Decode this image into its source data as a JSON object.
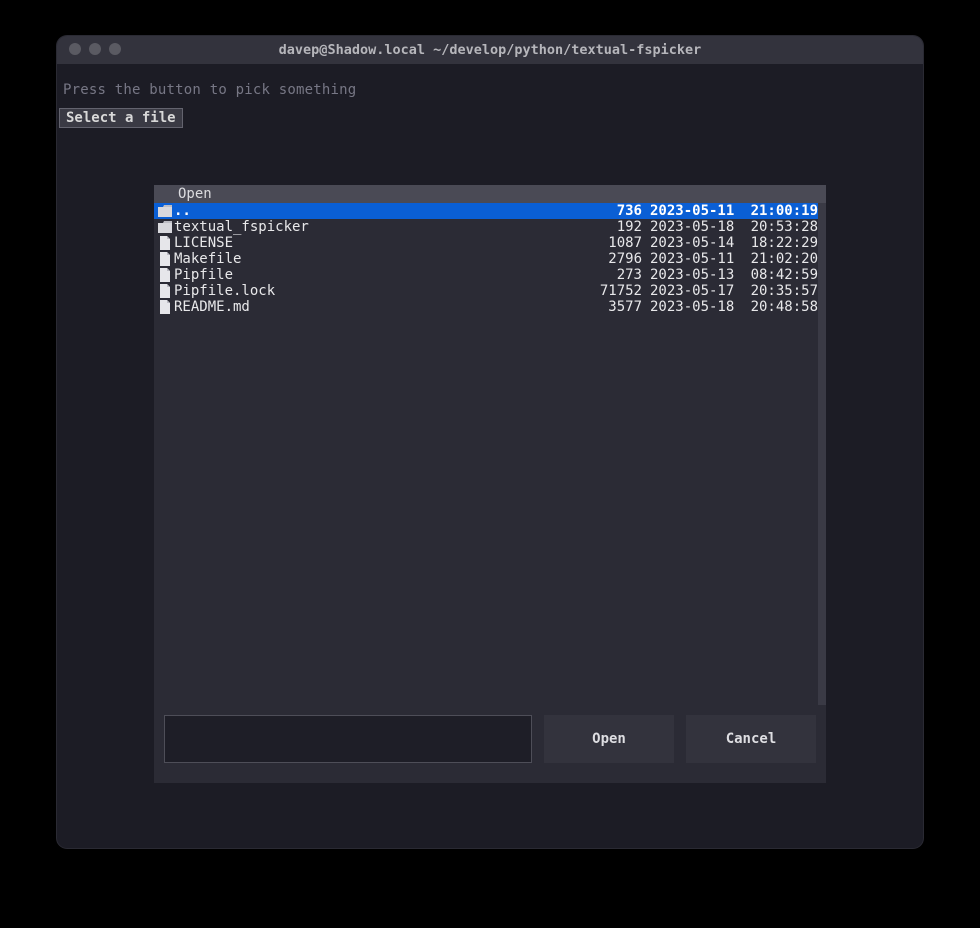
{
  "window": {
    "title": "davep@Shadow.local ~/develop/python/textual-fspicker"
  },
  "prompt": "Press the button to pick something",
  "select_button_label": "Select a file",
  "dialog": {
    "title": "Open",
    "filename_value": "",
    "open_label": "Open",
    "cancel_label": "Cancel",
    "entries": [
      {
        "name": "..",
        "type": "dir",
        "size": "736",
        "date": "2023-05-11",
        "time": "21:00:19",
        "selected": true
      },
      {
        "name": "textual_fspicker",
        "type": "dir",
        "size": "192",
        "date": "2023-05-18",
        "time": "20:53:28",
        "selected": false
      },
      {
        "name": "LICENSE",
        "type": "file",
        "size": "1087",
        "date": "2023-05-14",
        "time": "18:22:29",
        "selected": false
      },
      {
        "name": "Makefile",
        "type": "file",
        "size": "2796",
        "date": "2023-05-11",
        "time": "21:02:20",
        "selected": false
      },
      {
        "name": "Pipfile",
        "type": "file",
        "size": "273",
        "date": "2023-05-13",
        "time": "08:42:59",
        "selected": false
      },
      {
        "name": "Pipfile.lock",
        "type": "file",
        "size": "71752",
        "date": "2023-05-17",
        "time": "20:35:57",
        "selected": false
      },
      {
        "name": "README.md",
        "type": "file",
        "size": "3577",
        "date": "2023-05-18",
        "time": "20:48:58",
        "selected": false
      }
    ]
  }
}
